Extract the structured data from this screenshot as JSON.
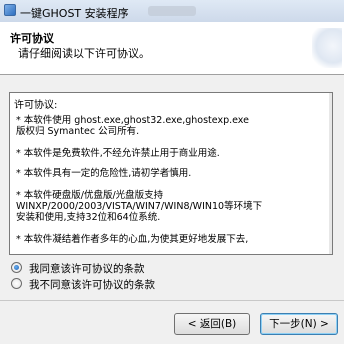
{
  "window": {
    "title": "一键GHOST 安装程序"
  },
  "header": {
    "title": "许可协议",
    "subtitle": "请仔细阅读以下许可协议。"
  },
  "license": {
    "heading": "许可协议:",
    "items": [
      [
        "* 本软件使用 ghost.exe,ghost32.exe,ghostexp.exe",
        "  版权归 Symantec 公司所有."
      ],
      [
        "* 本软件是免费软件,不经允许禁止用于商业用途."
      ],
      [
        "* 本软件具有一定的危险性,请初学者慎用."
      ],
      [
        "* 本软件硬盘版/优盘版/光盘版支持",
        "  WINXP/2000/2003/VISTA/WIN7/WIN8/WIN10等环境下",
        "  安装和使用,支持32位和64位系统."
      ],
      [
        "* 本软件凝结着作者多年的心血,为使其更好地发展下去,"
      ]
    ]
  },
  "options": {
    "accept": "我同意该许可协议的条款",
    "decline": "我不同意该许可协议的条款",
    "selected": "accept"
  },
  "buttons": {
    "back": "< 返回(B)",
    "next": "下一步(N) >"
  }
}
